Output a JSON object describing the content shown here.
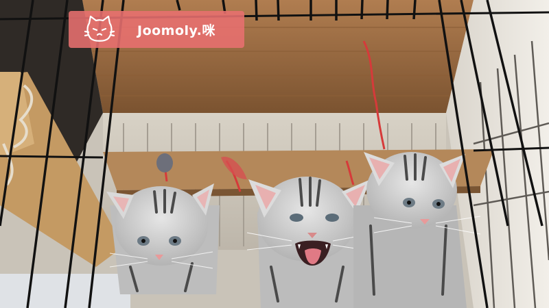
{
  "watermark": {
    "text": "Joomoly.咪",
    "logo_icon": "cat-face-icon",
    "color": "#e87070"
  },
  "scene": {
    "colors": {
      "wood_ceiling": "#a8764c",
      "cage_wire": "#111111",
      "kitten_fur": "#cfcfcf",
      "kitten_stripes": "#4a4a4a",
      "nose_pink": "#e89a9a",
      "string_red": "#d63a3a"
    }
  }
}
